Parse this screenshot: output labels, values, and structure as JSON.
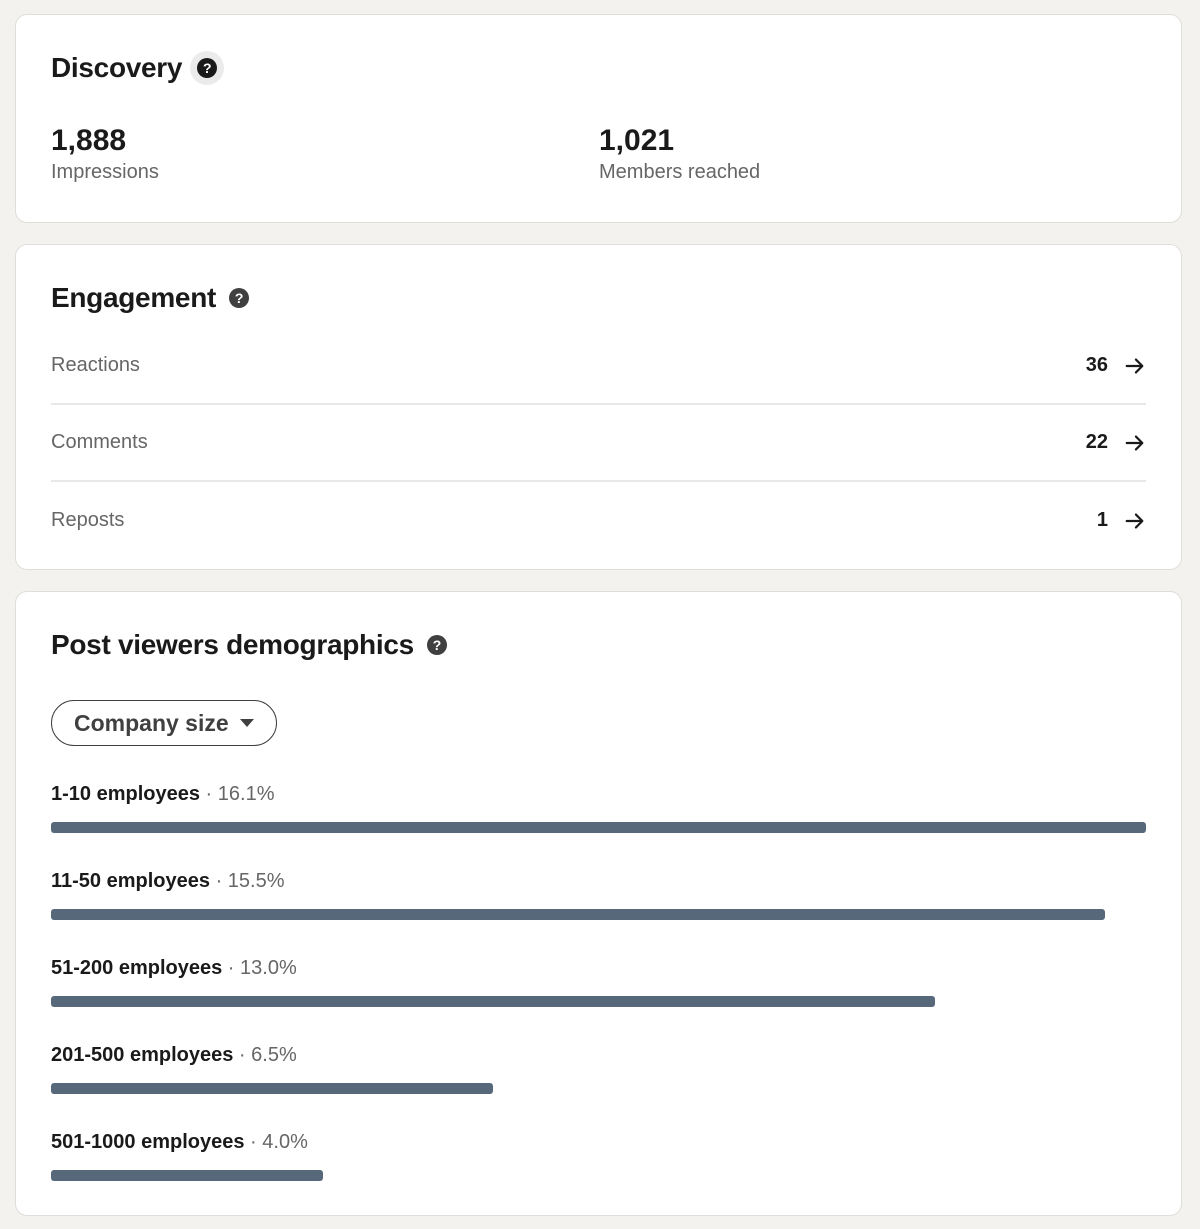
{
  "discovery": {
    "title": "Discovery",
    "help_icon": "question-circle-icon",
    "metrics": [
      {
        "value": "1,888",
        "label": "Impressions"
      },
      {
        "value": "1,021",
        "label": "Members reached"
      }
    ]
  },
  "engagement": {
    "title": "Engagement",
    "help_icon": "question-circle-icon",
    "rows": [
      {
        "label": "Reactions",
        "value": "36",
        "icon": "arrow-right-icon"
      },
      {
        "label": "Comments",
        "value": "22",
        "icon": "arrow-right-icon"
      },
      {
        "label": "Reposts",
        "value": "1",
        "icon": "arrow-right-icon"
      }
    ]
  },
  "demographics": {
    "title": "Post viewers demographics",
    "help_icon": "question-circle-icon",
    "dropdown": {
      "selected": "Company size",
      "icon": "caret-down-icon"
    },
    "separator": "·",
    "bar_color": "#56687a",
    "items": [
      {
        "label": "1-10 employees",
        "percent_text": "16.1%",
        "percent": 16.1
      },
      {
        "label": "11-50 employees",
        "percent_text": "15.5%",
        "percent": 15.5
      },
      {
        "label": "51-200 employees",
        "percent_text": "13.0%",
        "percent": 13.0
      },
      {
        "label": "201-500 employees",
        "percent_text": "6.5%",
        "percent": 6.5
      },
      {
        "label": "501-1000 employees",
        "percent_text": "4.0%",
        "percent": 4.0
      }
    ]
  },
  "colors": {
    "page_background": "#f3f2ef",
    "card_background": "#ffffff",
    "bar": "#56687a"
  }
}
